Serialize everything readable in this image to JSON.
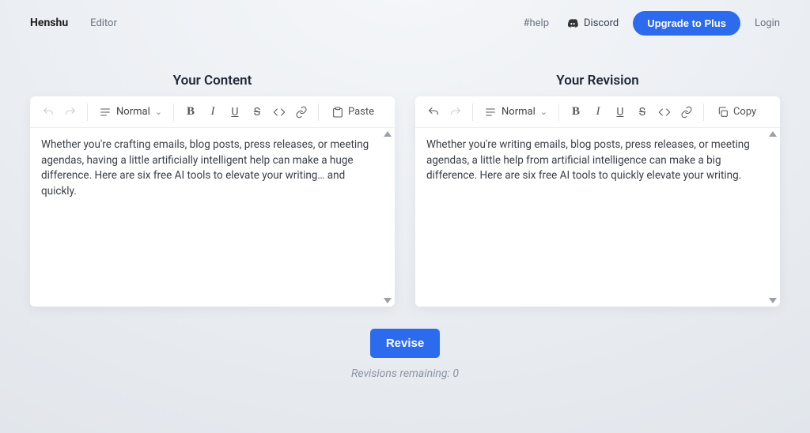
{
  "nav": {
    "brand": "Henshu",
    "editor_link": "Editor",
    "help_link": "#help",
    "discord_label": "Discord",
    "upgrade_label": "Upgrade to Plus",
    "login_label": "Login"
  },
  "panels": {
    "left": {
      "title": "Your Content",
      "format_label": "Normal",
      "paste_label": "Paste",
      "text": "Whether you're crafting emails, blog posts, press releases, or meeting agendas, having a little artificially intelligent help can make a huge difference. Here are six free AI tools to elevate your writing… and quickly."
    },
    "right": {
      "title": "Your Revision",
      "format_label": "Normal",
      "copy_label": "Copy",
      "text": "Whether you're writing emails, blog posts, press releases, or meeting agendas, a little help from artificial intelligence can make a big difference. Here are six free AI tools to quickly elevate your writing."
    }
  },
  "actions": {
    "revise_label": "Revise",
    "remaining_label": "Revisions remaining: 0"
  }
}
